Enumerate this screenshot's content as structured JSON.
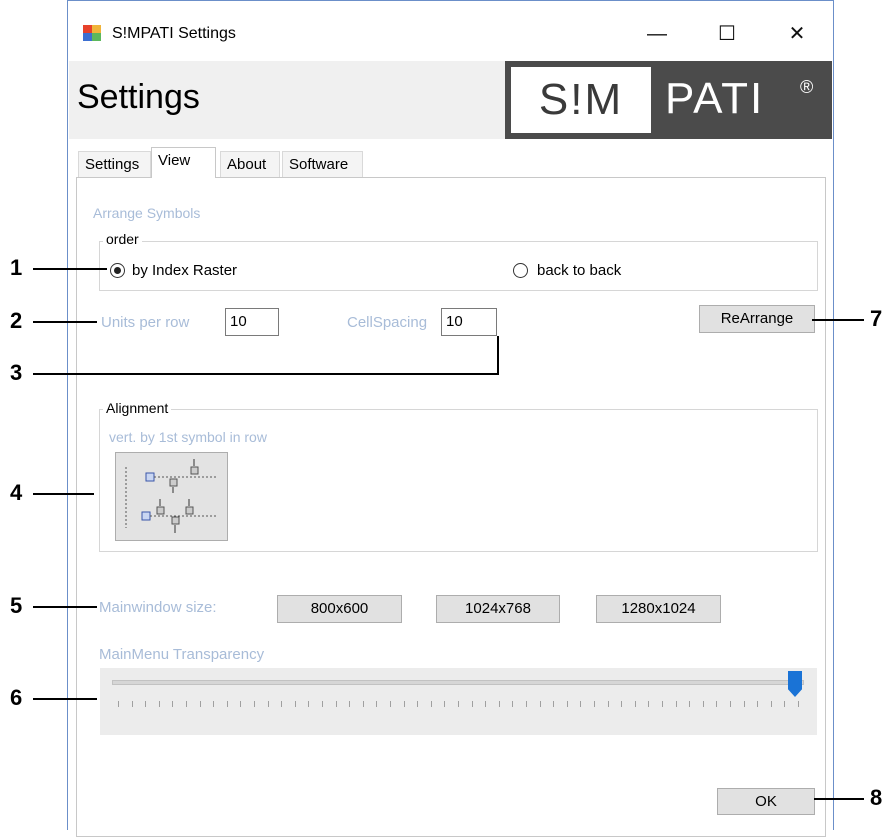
{
  "window": {
    "title": "S!MPATI  Settings",
    "controls": {
      "minimize": "—",
      "maximize": "☐",
      "close": "✕"
    }
  },
  "header": {
    "title": "Settings",
    "logo": {
      "left": "S!M",
      "right": "PATI",
      "reg": "®"
    }
  },
  "tabs": [
    {
      "label": "Settings",
      "active": false
    },
    {
      "label": "View",
      "active": true
    },
    {
      "label": "About",
      "active": false
    },
    {
      "label": "Software",
      "active": false
    }
  ],
  "arrange": {
    "section_label": "Arrange Symbols",
    "order_legend": "order",
    "option_index_raster": "by Index Raster",
    "option_back_to_back": "back to back",
    "selected": "by Index Raster",
    "units_per_row_label": "Units per row",
    "units_per_row_value": "10",
    "cellspacing_label": "CellSpacing",
    "cellspacing_value": "10",
    "rearrange_button": "ReArrange"
  },
  "alignment": {
    "legend": "Alignment",
    "mode_label": "vert. by 1st symbol in row"
  },
  "mainwindow": {
    "label": "Mainwindow size:",
    "sizes": [
      "800x600",
      "1024x768",
      "1280x1024"
    ]
  },
  "transparency": {
    "label": "MainMenu Transparency",
    "value_fraction": 1.0
  },
  "ok_button": "OK",
  "callouts": [
    "1",
    "2",
    "3",
    "4",
    "5",
    "6",
    "7",
    "8"
  ],
  "colors": {
    "muted_label": "#a8bcd8",
    "slider_thumb": "#1a73d6",
    "logo_bg": "#4b4b4b"
  }
}
